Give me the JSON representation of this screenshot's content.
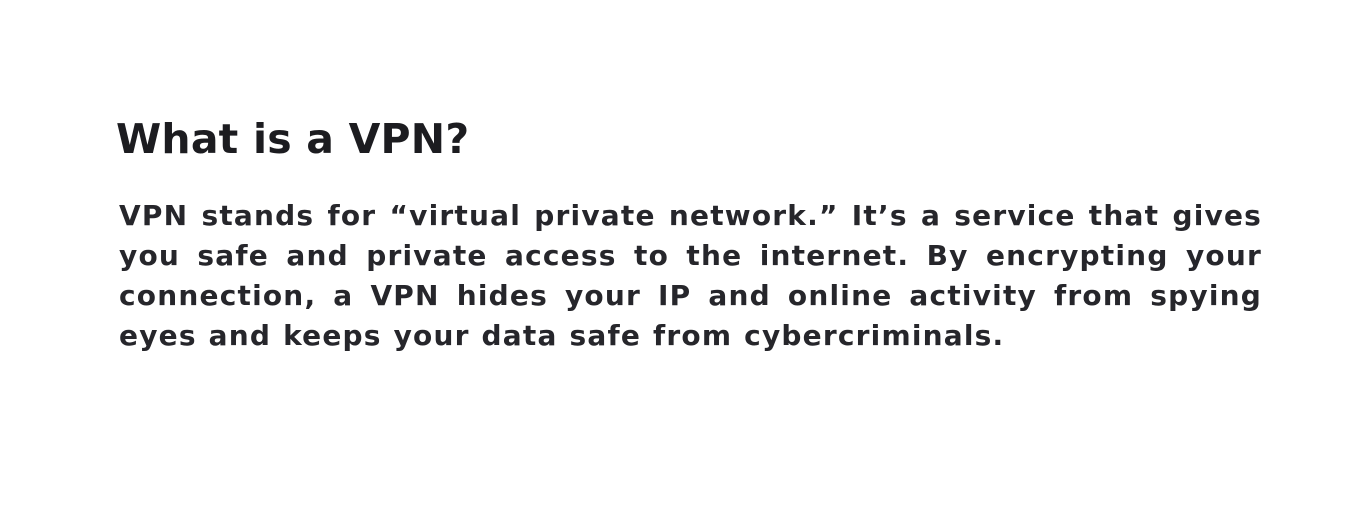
{
  "section": {
    "heading": "What is a VPN?",
    "paragraph": "VPN stands for “virtual private network.” It’s a service that gives you safe and private access to the internet. By encrypting your connection, a VPN hides your IP and online activity from spying eyes and keeps your data safe from cybercriminals."
  }
}
